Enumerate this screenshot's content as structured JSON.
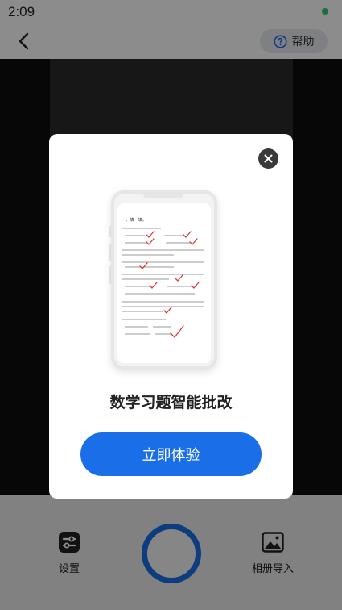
{
  "status_bar": {
    "time": "2:09"
  },
  "topbar": {
    "help_label": "帮助"
  },
  "bottom_bar": {
    "settings_label": "设置",
    "album_label": "相册导入"
  },
  "modal": {
    "title": "数学习题智能批改",
    "cta_label": "立即体验",
    "illustration": {
      "worksheet_heading": "一、填一填。"
    }
  },
  "colors": {
    "accent": "#1a6fe8",
    "check": "#d93a3a"
  }
}
